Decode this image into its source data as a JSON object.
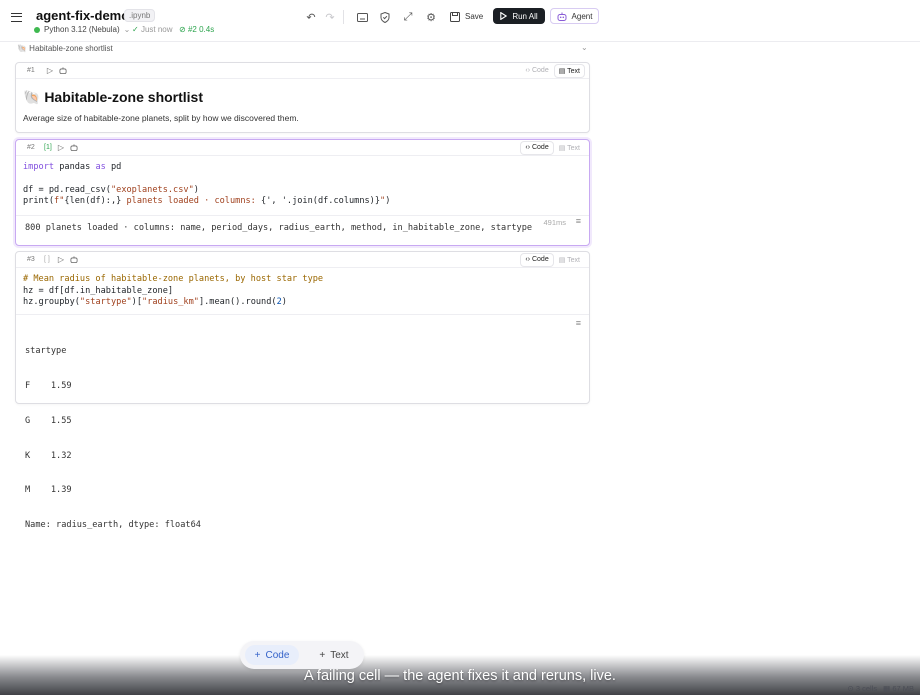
{
  "header": {
    "title": "agent-fix-demo",
    "file_ext": ".ipynb",
    "kernel": "Python 3.12 (Nebula)",
    "saved_status": "Just now",
    "last_run_cell": "#2",
    "last_run_time": "0.4s",
    "save_label": "Save",
    "run_all_label": "Run All",
    "agent_label": "Agent"
  },
  "breadcrumb": "🐚 Habitable-zone shortlist",
  "toggle": {
    "code": "Code",
    "text": "Text"
  },
  "cells": [
    {
      "number": "#1",
      "type": "markdown",
      "heading": "🐚 Habitable-zone shortlist",
      "paragraph": "Average size of habitable-zone planets, split by how we discovered them."
    },
    {
      "number": "#2",
      "exec_count": "[1]",
      "code_lines": [
        "import pandas as pd",
        "",
        "df = pd.read_csv(\"exoplanets.csv\")",
        "print(f\"{len(df):,} planets loaded · columns: {', '.join(df.columns)}\")"
      ],
      "duration": "491ms",
      "output": "800 planets loaded · columns: name, period_days, radius_earth, method, in_habitable_zone, startype"
    },
    {
      "number": "#3",
      "exec_count": "[ ]",
      "code_lines": [
        "# Mean radius of habitable-zone planets, by host star type",
        "hz = df[df.in_habitable_zone]",
        "hz.groupby(\"startype\")[\"radius_km\"].mean().round(2)"
      ],
      "output_lines": [
        "startype",
        "F    1.59",
        "G    1.55",
        "K    1.32",
        "M    1.39",
        "Name: radius_earth, dtype: float64"
      ]
    }
  ],
  "add_bar": {
    "code": "Code",
    "text": "Text"
  },
  "caption": "A failing cell — the agent fixes it and reruns, live.",
  "status": {
    "cells": "3 cells",
    "memory": "67 MB"
  },
  "colors": {
    "accent": "#c8a9f2",
    "run_all_bg": "#1b1f24",
    "success": "#2da44e"
  }
}
